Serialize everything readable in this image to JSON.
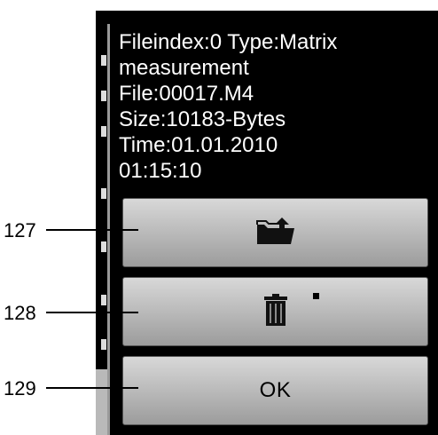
{
  "dialog": {
    "info_lines": [
      "Fileindex:0 Type:Matrix",
      "measurement",
      "File:00017.M4",
      "Size:10183-Bytes",
      "Time:01.01.2010",
      "01:15:10"
    ]
  },
  "buttons": {
    "open_icon": "folder-export-icon",
    "delete_icon": "trash-icon",
    "ok_label": "OK"
  },
  "callouts": {
    "open": "127",
    "delete": "128",
    "ok": "129"
  },
  "colors": {
    "screen_bg": "#000000",
    "text": "#ffffff",
    "button_top": "#d8d8d8",
    "button_bottom": "#9c9c9c"
  }
}
